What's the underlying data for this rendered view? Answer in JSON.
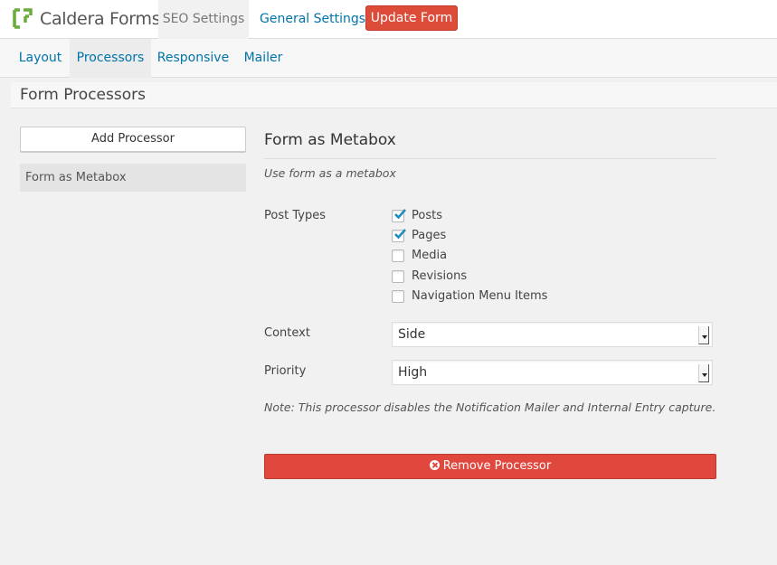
{
  "header": {
    "brand": "Caldera Forms",
    "tabs": {
      "seo": "SEO Settings",
      "general": "General Settings"
    },
    "update_button": "Update Form"
  },
  "subnav": {
    "layout": "Layout",
    "processors": "Processors",
    "responsive": "Responsive",
    "mailer": "Mailer",
    "active": "Processors"
  },
  "section": {
    "title": "Form Processors"
  },
  "sidebar": {
    "add_button": "Add Processor",
    "items": [
      {
        "label": "Form as Metabox"
      }
    ]
  },
  "panel": {
    "title": "Form as Metabox",
    "description": "Use form as a metabox",
    "post_types": {
      "label": "Post Types",
      "options": [
        {
          "label": "Posts",
          "checked": true
        },
        {
          "label": "Pages",
          "checked": true
        },
        {
          "label": "Media",
          "checked": false
        },
        {
          "label": "Revisions",
          "checked": false
        },
        {
          "label": "Navigation Menu Items",
          "checked": false
        }
      ]
    },
    "context": {
      "label": "Context",
      "value": "Side"
    },
    "priority": {
      "label": "Priority",
      "value": "High"
    },
    "note": "Note: This processor disables the Notification Mailer and Internal Entry capture.",
    "remove_button": "Remove Processor"
  },
  "colors": {
    "accent_red": "#e0483d",
    "link_blue": "#0073aa",
    "logo_green": "#6bab3e"
  },
  "icons": {
    "logo": "caldera-bracket-logo",
    "remove": "times-circle-icon",
    "check": "check-icon"
  }
}
